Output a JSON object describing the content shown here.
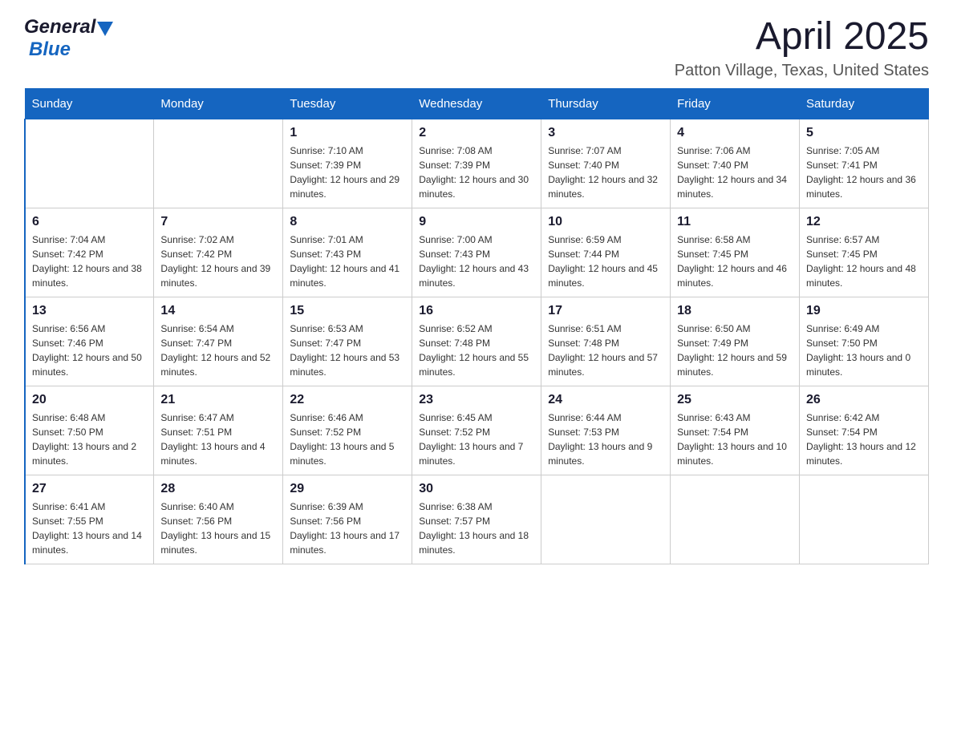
{
  "header": {
    "logo_general": "General",
    "logo_blue": "Blue",
    "title": "April 2025",
    "subtitle": "Patton Village, Texas, United States"
  },
  "weekdays": [
    "Sunday",
    "Monday",
    "Tuesday",
    "Wednesday",
    "Thursday",
    "Friday",
    "Saturday"
  ],
  "weeks": [
    [
      {
        "day": "",
        "sunrise": "",
        "sunset": "",
        "daylight": ""
      },
      {
        "day": "",
        "sunrise": "",
        "sunset": "",
        "daylight": ""
      },
      {
        "day": "1",
        "sunrise": "Sunrise: 7:10 AM",
        "sunset": "Sunset: 7:39 PM",
        "daylight": "Daylight: 12 hours and 29 minutes."
      },
      {
        "day": "2",
        "sunrise": "Sunrise: 7:08 AM",
        "sunset": "Sunset: 7:39 PM",
        "daylight": "Daylight: 12 hours and 30 minutes."
      },
      {
        "day": "3",
        "sunrise": "Sunrise: 7:07 AM",
        "sunset": "Sunset: 7:40 PM",
        "daylight": "Daylight: 12 hours and 32 minutes."
      },
      {
        "day": "4",
        "sunrise": "Sunrise: 7:06 AM",
        "sunset": "Sunset: 7:40 PM",
        "daylight": "Daylight: 12 hours and 34 minutes."
      },
      {
        "day": "5",
        "sunrise": "Sunrise: 7:05 AM",
        "sunset": "Sunset: 7:41 PM",
        "daylight": "Daylight: 12 hours and 36 minutes."
      }
    ],
    [
      {
        "day": "6",
        "sunrise": "Sunrise: 7:04 AM",
        "sunset": "Sunset: 7:42 PM",
        "daylight": "Daylight: 12 hours and 38 minutes."
      },
      {
        "day": "7",
        "sunrise": "Sunrise: 7:02 AM",
        "sunset": "Sunset: 7:42 PM",
        "daylight": "Daylight: 12 hours and 39 minutes."
      },
      {
        "day": "8",
        "sunrise": "Sunrise: 7:01 AM",
        "sunset": "Sunset: 7:43 PM",
        "daylight": "Daylight: 12 hours and 41 minutes."
      },
      {
        "day": "9",
        "sunrise": "Sunrise: 7:00 AM",
        "sunset": "Sunset: 7:43 PM",
        "daylight": "Daylight: 12 hours and 43 minutes."
      },
      {
        "day": "10",
        "sunrise": "Sunrise: 6:59 AM",
        "sunset": "Sunset: 7:44 PM",
        "daylight": "Daylight: 12 hours and 45 minutes."
      },
      {
        "day": "11",
        "sunrise": "Sunrise: 6:58 AM",
        "sunset": "Sunset: 7:45 PM",
        "daylight": "Daylight: 12 hours and 46 minutes."
      },
      {
        "day": "12",
        "sunrise": "Sunrise: 6:57 AM",
        "sunset": "Sunset: 7:45 PM",
        "daylight": "Daylight: 12 hours and 48 minutes."
      }
    ],
    [
      {
        "day": "13",
        "sunrise": "Sunrise: 6:56 AM",
        "sunset": "Sunset: 7:46 PM",
        "daylight": "Daylight: 12 hours and 50 minutes."
      },
      {
        "day": "14",
        "sunrise": "Sunrise: 6:54 AM",
        "sunset": "Sunset: 7:47 PM",
        "daylight": "Daylight: 12 hours and 52 minutes."
      },
      {
        "day": "15",
        "sunrise": "Sunrise: 6:53 AM",
        "sunset": "Sunset: 7:47 PM",
        "daylight": "Daylight: 12 hours and 53 minutes."
      },
      {
        "day": "16",
        "sunrise": "Sunrise: 6:52 AM",
        "sunset": "Sunset: 7:48 PM",
        "daylight": "Daylight: 12 hours and 55 minutes."
      },
      {
        "day": "17",
        "sunrise": "Sunrise: 6:51 AM",
        "sunset": "Sunset: 7:48 PM",
        "daylight": "Daylight: 12 hours and 57 minutes."
      },
      {
        "day": "18",
        "sunrise": "Sunrise: 6:50 AM",
        "sunset": "Sunset: 7:49 PM",
        "daylight": "Daylight: 12 hours and 59 minutes."
      },
      {
        "day": "19",
        "sunrise": "Sunrise: 6:49 AM",
        "sunset": "Sunset: 7:50 PM",
        "daylight": "Daylight: 13 hours and 0 minutes."
      }
    ],
    [
      {
        "day": "20",
        "sunrise": "Sunrise: 6:48 AM",
        "sunset": "Sunset: 7:50 PM",
        "daylight": "Daylight: 13 hours and 2 minutes."
      },
      {
        "day": "21",
        "sunrise": "Sunrise: 6:47 AM",
        "sunset": "Sunset: 7:51 PM",
        "daylight": "Daylight: 13 hours and 4 minutes."
      },
      {
        "day": "22",
        "sunrise": "Sunrise: 6:46 AM",
        "sunset": "Sunset: 7:52 PM",
        "daylight": "Daylight: 13 hours and 5 minutes."
      },
      {
        "day": "23",
        "sunrise": "Sunrise: 6:45 AM",
        "sunset": "Sunset: 7:52 PM",
        "daylight": "Daylight: 13 hours and 7 minutes."
      },
      {
        "day": "24",
        "sunrise": "Sunrise: 6:44 AM",
        "sunset": "Sunset: 7:53 PM",
        "daylight": "Daylight: 13 hours and 9 minutes."
      },
      {
        "day": "25",
        "sunrise": "Sunrise: 6:43 AM",
        "sunset": "Sunset: 7:54 PM",
        "daylight": "Daylight: 13 hours and 10 minutes."
      },
      {
        "day": "26",
        "sunrise": "Sunrise: 6:42 AM",
        "sunset": "Sunset: 7:54 PM",
        "daylight": "Daylight: 13 hours and 12 minutes."
      }
    ],
    [
      {
        "day": "27",
        "sunrise": "Sunrise: 6:41 AM",
        "sunset": "Sunset: 7:55 PM",
        "daylight": "Daylight: 13 hours and 14 minutes."
      },
      {
        "day": "28",
        "sunrise": "Sunrise: 6:40 AM",
        "sunset": "Sunset: 7:56 PM",
        "daylight": "Daylight: 13 hours and 15 minutes."
      },
      {
        "day": "29",
        "sunrise": "Sunrise: 6:39 AM",
        "sunset": "Sunset: 7:56 PM",
        "daylight": "Daylight: 13 hours and 17 minutes."
      },
      {
        "day": "30",
        "sunrise": "Sunrise: 6:38 AM",
        "sunset": "Sunset: 7:57 PM",
        "daylight": "Daylight: 13 hours and 18 minutes."
      },
      {
        "day": "",
        "sunrise": "",
        "sunset": "",
        "daylight": ""
      },
      {
        "day": "",
        "sunrise": "",
        "sunset": "",
        "daylight": ""
      },
      {
        "day": "",
        "sunrise": "",
        "sunset": "",
        "daylight": ""
      }
    ]
  ]
}
